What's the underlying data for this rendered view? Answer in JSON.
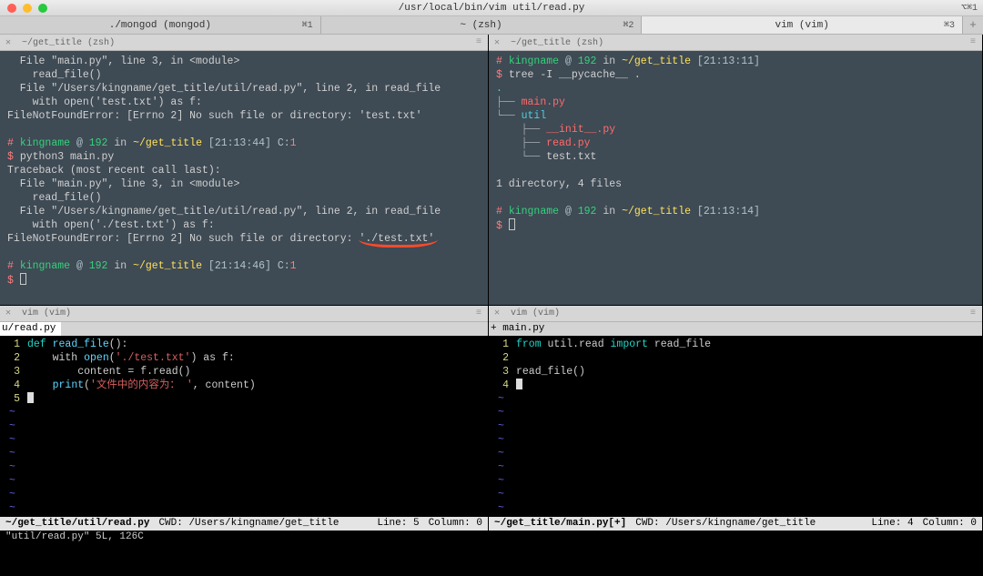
{
  "title": "/usr/local/bin/vim util/read.py",
  "title_key": "⌥⌘1",
  "tabs": [
    {
      "label": "./mongod (mongod)",
      "key": "⌘1",
      "active": false
    },
    {
      "label": "~ (zsh)",
      "key": "⌘2",
      "active": false
    },
    {
      "label": "vim (vim)",
      "key": "⌘3",
      "active": true
    }
  ],
  "top_left": {
    "pane_label": "~/get_title (zsh)",
    "lines_head": "  File \"main.py\", line 3, in <module>\n    read_file()\n  File \"/Users/kingname/get_title/util/read.py\", line 2, in read_file\n    with open('test.txt') as f:\nFileNotFoundError: [Errno 2] No such file or directory: 'test.txt'\n",
    "prompt1_user": "kingname",
    "prompt1_host": "192",
    "prompt1_path": "~/get_title",
    "prompt1_time": "[21:13:44]",
    "prompt1_c": "C:",
    "prompt1_cn": "1",
    "cmd1": "python3 main.py",
    "traceback": "Traceback (most recent call last):\n  File \"main.py\", line 3, in <module>\n    read_file()\n  File \"/Users/kingname/get_title/util/read.py\", line 2, in read_file\n    with open('./test.txt') as f:",
    "err_prefix": "FileNotFoundError: [Errno 2] No such file or directory: ",
    "err_path": "'./test.txt'",
    "prompt2_time": "[21:14:46]"
  },
  "top_right": {
    "pane_label": "~/get_title (zsh)",
    "p1_time": "[21:13:11]",
    "cmd": "tree -I __pycache__ .",
    "tree_lines": [
      ".",
      "├── main.py",
      "└── util",
      "    ├── __init__.py",
      "    ├── read.py",
      "    └── test.txt"
    ],
    "summary": "1 directory, 4 files",
    "p2_time": "[21:13:14]"
  },
  "bottom_left": {
    "pane_label": "vim (vim)",
    "file_tab": "u/read.py",
    "lines": {
      "1": {
        "pre": "def ",
        "fn": "read_file",
        "post": "():"
      },
      "2": {
        "pre": "    with ",
        "kw": "open",
        "paren": "(",
        "str": "'./test.txt'",
        "post": ") as f:"
      },
      "3": "        content = f.read()",
      "4": {
        "pre": "    ",
        "kw": "print",
        "paren": "(",
        "str": "'文件中的内容为： '",
        "post": ", content)"
      },
      "5": ""
    },
    "status_file": "~/get_title/util/read.py",
    "status_cwd": "CWD: /Users/kingname/get_title",
    "status_line": "Line: 5",
    "status_col": "Column: 0",
    "msg": "\"util/read.py\" 5L, 126C"
  },
  "bottom_right": {
    "pane_label": "vim (vim)",
    "file_tab": "+ main.py",
    "lines": {
      "1": {
        "kw1": "from",
        "m": " util.read ",
        "kw2": "import",
        "rest": " read_file"
      },
      "3": "read_file()",
      "4": ""
    },
    "status_file": "~/get_title/main.py[+]",
    "status_cwd": "CWD: /Users/kingname/get_title",
    "status_line": "Line: 4",
    "status_col": "Column: 0"
  },
  "prompt": {
    "user": "kingname",
    "host": "192",
    "path": "~/get_title",
    "at": "@",
    "in": "in"
  }
}
